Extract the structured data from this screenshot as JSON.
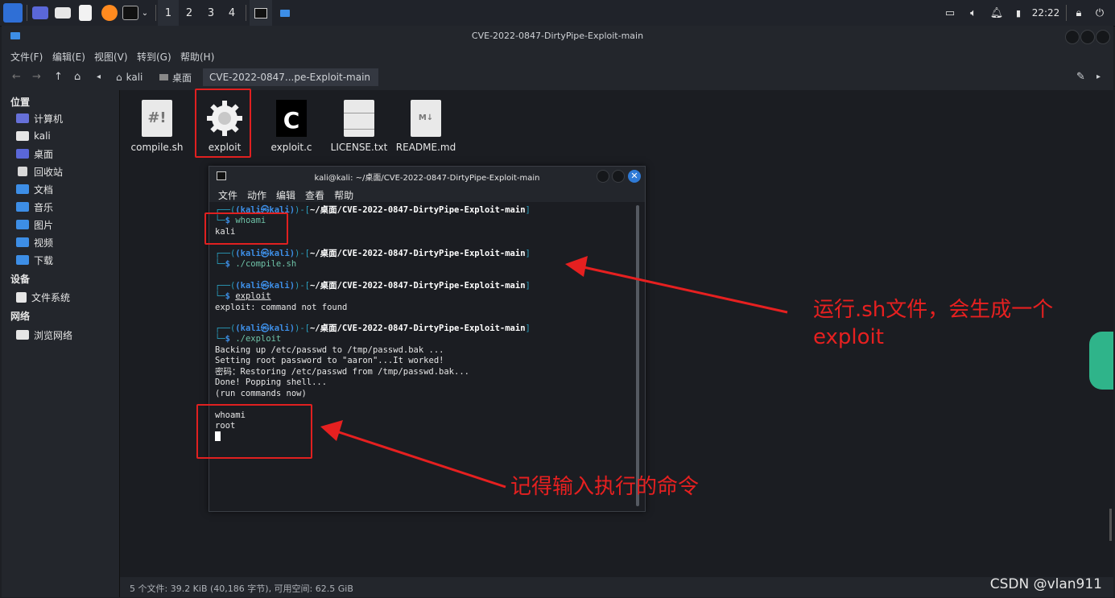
{
  "panel": {
    "workspaces": [
      "1",
      "2",
      "3",
      "4"
    ],
    "clock": "22:22"
  },
  "window": {
    "title": "CVE-2022-0847-DirtyPipe-Exploit-main",
    "menu": [
      "文件(F)",
      "编辑(E)",
      "视图(V)",
      "转到(G)",
      "帮助(H)"
    ],
    "breadcrumbs": [
      "kali",
      "桌面",
      "CVE-2022-0847...pe-Exploit-main"
    ]
  },
  "sidebar": {
    "sections": [
      {
        "label": "位置",
        "items": [
          "计算机",
          "kali",
          "桌面",
          "回收站",
          "文档",
          "音乐",
          "图片",
          "视频",
          "下载"
        ]
      },
      {
        "label": "设备",
        "items": [
          "文件系统"
        ]
      },
      {
        "label": "网络",
        "items": [
          "浏览网络"
        ]
      }
    ]
  },
  "files": [
    {
      "name": "compile.sh",
      "icon": "script-icon"
    },
    {
      "name": "exploit",
      "icon": "executable-gear-icon"
    },
    {
      "name": "exploit.c",
      "icon": "c-source-icon"
    },
    {
      "name": "LICENSE.txt",
      "icon": "text-file-icon"
    },
    {
      "name": "README.md",
      "icon": "markdown-file-icon"
    }
  ],
  "status": "5 个文件: 39.2 KiB (40,186 字节), 可用空间: 62.5 GiB",
  "terminal": {
    "title": "kali@kali: ~/桌面/CVE-2022-0847-DirtyPipe-Exploit-main",
    "menu": [
      "文件",
      "动作",
      "编辑",
      "查看",
      "帮助"
    ],
    "prompt_user": "(kali㉿kali)",
    "prompt_path": "~/桌面/CVE-2022-0847-DirtyPipe-Exploit-main",
    "cmd1": "whoami",
    "out1": "kali",
    "cmd2": "./compile.sh",
    "cmd3": "exploit",
    "out3": "exploit: command not found",
    "cmd4": "./exploit",
    "out4": [
      "Backing up /etc/passwd to /tmp/passwd.bak ...",
      "Setting root password to \"aaron\"...It worked!",
      "密码：Restoring /etc/passwd from /tmp/passwd.bak...",
      "Done! Popping shell...",
      "(run commands now)"
    ],
    "out5": [
      "whoami",
      "root"
    ]
  },
  "annotations": {
    "note1": "运行.sh文件，会生成一个exploit",
    "note2": "记得输入执行的命令",
    "color": "#e62020"
  },
  "watermark": "CSDN @vlan911"
}
